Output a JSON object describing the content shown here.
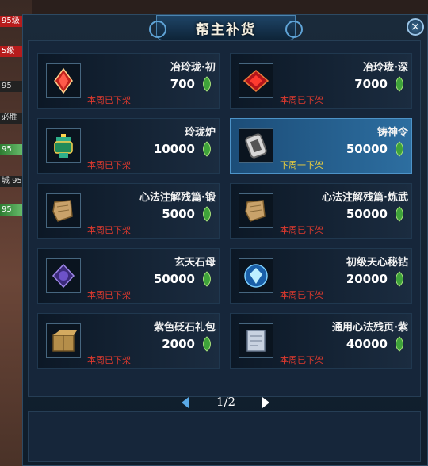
{
  "window": {
    "title": "帮主补货",
    "close_label": "×"
  },
  "background": {
    "bars": [
      "95级",
      "5级",
      "95",
      "必胜",
      "95",
      "城 95",
      "95"
    ]
  },
  "items": [
    {
      "name": "冶玲珑·初",
      "price": "700",
      "status": "本周已下架",
      "icon": "red-gem-icon",
      "selected": false
    },
    {
      "name": "冶玲珑·深",
      "price": "7000",
      "status": "本周已下架",
      "icon": "red-crystal-icon",
      "selected": false
    },
    {
      "name": "玲珑炉",
      "price": "10000",
      "status": "本周已下架",
      "icon": "green-furnace-icon",
      "selected": false
    },
    {
      "name": "铸神令",
      "price": "50000",
      "status": "下周一下架",
      "icon": "silver-token-icon",
      "selected": true
    },
    {
      "name": "心法注解残篇·锻",
      "price": "5000",
      "status": "本周已下架",
      "icon": "scroll-fragment-icon",
      "selected": false
    },
    {
      "name": "心法注解残篇·炼武",
      "price": "50000",
      "status": "本周已下架",
      "icon": "scroll-fragment-icon",
      "selected": false
    },
    {
      "name": "玄天石母",
      "price": "50000",
      "status": "本周已下架",
      "icon": "purple-stone-icon",
      "selected": false
    },
    {
      "name": "初级天心秘钻",
      "price": "20000",
      "status": "本周已下架",
      "icon": "blue-diamond-icon",
      "selected": false
    },
    {
      "name": "紫色砭石礼包",
      "price": "2000",
      "status": "本周已下架",
      "icon": "gift-box-icon",
      "selected": false
    },
    {
      "name": "通用心法残页·紫",
      "price": "40000",
      "status": "本周已下架",
      "icon": "paper-page-icon",
      "selected": false
    }
  ],
  "pager": {
    "page": "1/2"
  },
  "colors": {
    "status_removed": "#e03a2e",
    "status_next": "#f2d23a",
    "currency": "#3fa33a"
  }
}
